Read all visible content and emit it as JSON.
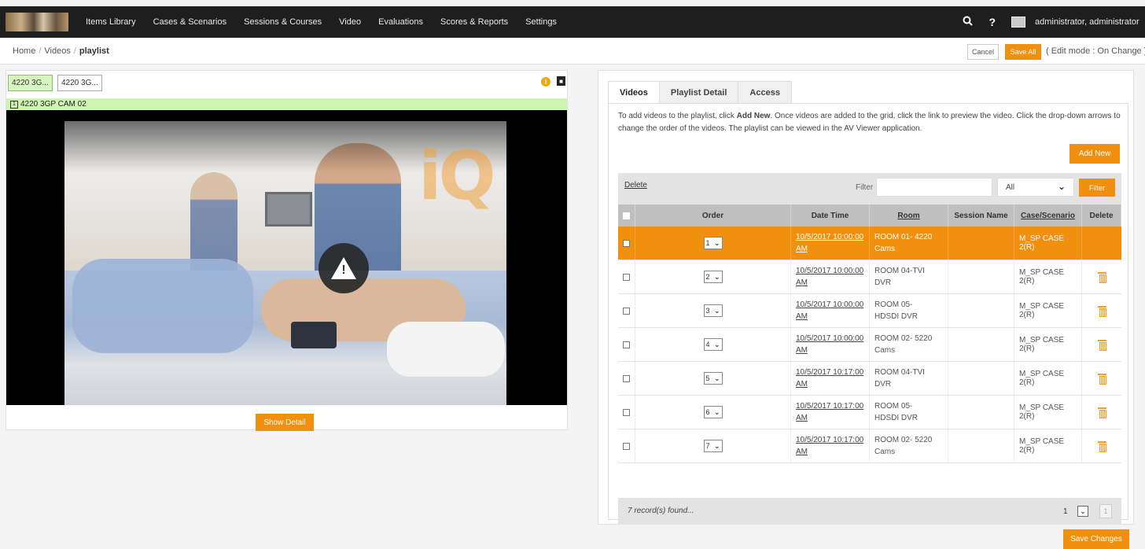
{
  "nav": {
    "items": [
      "Items Library",
      "Cases & Scenarios",
      "Sessions & Courses",
      "Video",
      "Evaluations",
      "Scores & Reports",
      "Settings"
    ],
    "search_icon": "search-icon",
    "help_label": "?",
    "user_name": "administrator, administrator"
  },
  "breadcrumb": {
    "home": "Home",
    "videos": "Videos",
    "current": "playlist"
  },
  "actions": {
    "cancel": "Cancel",
    "save_all": "Save All",
    "edit_mode": "( Edit mode : On Change )"
  },
  "player": {
    "cam_tabs": [
      "4220 3G...",
      "4220 3G..."
    ],
    "cam_number": "1",
    "cam_title": "4220 3GP CAM 02",
    "info_label": "i",
    "warning_label": "!",
    "show_detail": "Show Detail"
  },
  "panel": {
    "tabs": [
      "Videos",
      "Playlist Detail",
      "Access"
    ],
    "instructions_pre": "To add videos to the playlist, click ",
    "instructions_bold": "Add New",
    "instructions_post": ". Once videos are added to the grid, click the link to preview the video. Click the drop-down arrows to change the order of the videos. The playlist can be viewed in the AV Viewer application.",
    "add_new": "Add New",
    "delete_link": "Delete",
    "filter_label": "Filter",
    "filter_value": "",
    "filter_select": "All",
    "filter_button": "Filter",
    "save_changes": "Save Changes"
  },
  "grid": {
    "columns": {
      "order": "Order",
      "datetime": "Date Time",
      "room": "Room",
      "session": "Session Name",
      "case": "Case/Scenario",
      "delete": "Delete"
    },
    "rows": [
      {
        "order": "1",
        "dt1": "10/5/2017 10:00:00",
        "dt2": "AM",
        "room1": "ROOM 01- 4220",
        "room2": "Cams",
        "session": "",
        "case": "M_SP CASE 2(R)"
      },
      {
        "order": "2",
        "dt1": "10/5/2017 10:00:00",
        "dt2": "AM",
        "room1": "ROOM 04-TVI",
        "room2": "DVR",
        "session": "",
        "case": "M_SP CASE 2(R)"
      },
      {
        "order": "3",
        "dt1": "10/5/2017 10:00:00",
        "dt2": "AM",
        "room1": "ROOM 05-",
        "room2": "HDSDI DVR",
        "session": "",
        "case": "M_SP CASE 2(R)"
      },
      {
        "order": "4",
        "dt1": "10/5/2017 10:00:00",
        "dt2": "AM",
        "room1": "ROOM 02- 5220",
        "room2": "Cams",
        "session": "",
        "case": "M_SP CASE 2(R)"
      },
      {
        "order": "5",
        "dt1": "10/5/2017 10:17:00",
        "dt2": "AM",
        "room1": "ROOM 04-TVI",
        "room2": "DVR",
        "session": "",
        "case": "M_SP CASE 2(R)"
      },
      {
        "order": "6",
        "dt1": "10/5/2017 10:17:00",
        "dt2": "AM",
        "room1": "ROOM 05-",
        "room2": "HDSDI DVR",
        "session": "",
        "case": "M_SP CASE 2(R)"
      },
      {
        "order": "7",
        "dt1": "10/5/2017 10:17:00",
        "dt2": "AM",
        "room1": "ROOM 02- 5220",
        "room2": "Cams",
        "session": "",
        "case": "M_SP CASE 2(R)"
      }
    ],
    "records_found": "7 record(s) found...",
    "page_value": "1",
    "page_number": "1"
  },
  "colors": {
    "accent": "#f0900e",
    "nav_bg": "#1e1e1e",
    "cam_tab_active": "#d8f5c0"
  }
}
